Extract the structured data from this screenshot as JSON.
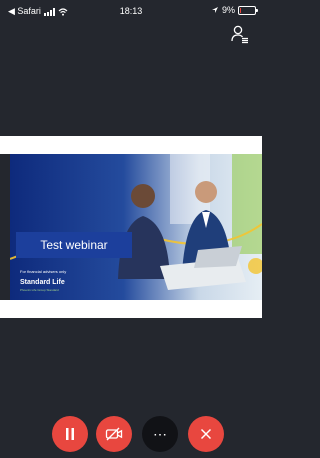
{
  "status_bar": {
    "back_app": "◀ Safari",
    "time": "18:13",
    "battery": "9%",
    "battery_level": 0.09
  },
  "slide": {
    "title": "Test webinar",
    "note": "For financial advisers only",
    "brand": "Standard Life",
    "tagline": "Phoenix Life Group Standard"
  },
  "controls": {
    "audio": "pause-icon",
    "video": "video-off-icon",
    "more": "⋯",
    "leave": "close-icon"
  },
  "colors": {
    "background": "#24272e",
    "control_red": "#e8473f",
    "slide_blue": "#1c3f9c"
  }
}
